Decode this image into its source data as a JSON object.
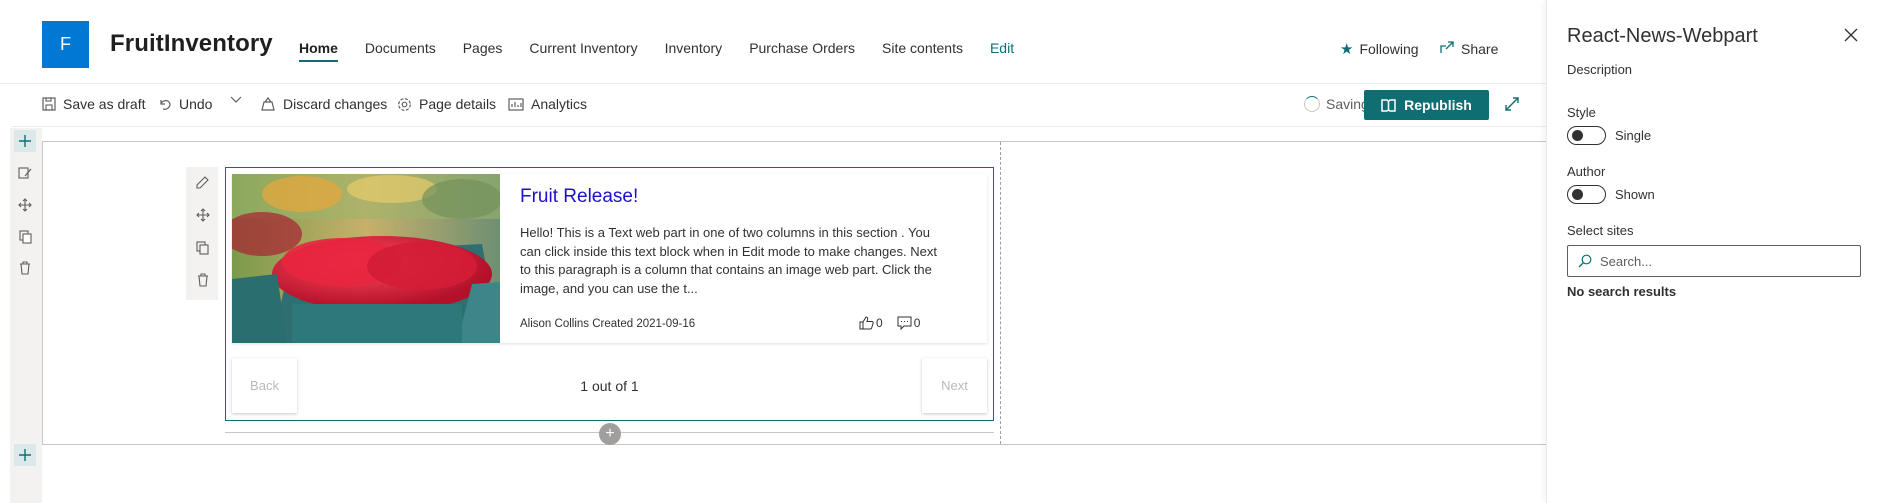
{
  "site": {
    "logo_letter": "F",
    "title": "FruitInventory",
    "nav": [
      {
        "label": "Home",
        "active": true
      },
      {
        "label": "Documents"
      },
      {
        "label": "Pages"
      },
      {
        "label": "Current Inventory"
      },
      {
        "label": "Inventory"
      },
      {
        "label": "Purchase Orders"
      },
      {
        "label": "Site contents"
      },
      {
        "label": "Edit"
      }
    ],
    "following_label": "Following",
    "share_label": "Share"
  },
  "commandbar": {
    "save_draft_label": "Save as draft",
    "undo_label": "Undo",
    "discard_label": "Discard changes",
    "page_details_label": "Page details",
    "analytics_label": "Analytics",
    "saving_label": "Saving",
    "republish_label": "Republish"
  },
  "webpart": {
    "news_item": {
      "title": "Fruit Release!",
      "description": "Hello! This is a Text web part in one of two columns in this section . You can click inside this text block when in Edit mode to make changes. Next to this paragraph is a column that contains an image web part. Click the image, and you can use the t...",
      "author_line": "Alison Collins Created 2021-09-16",
      "likes": "0",
      "comments": "0"
    },
    "pager": {
      "back_label": "Back",
      "next_label": "Next",
      "status": "1 out of 1"
    }
  },
  "panel": {
    "title": "React-News-Webpart",
    "description": "Description",
    "style_label": "Style",
    "style_toggle_text": "Single",
    "author_label": "Author",
    "author_toggle_text": "Shown",
    "select_sites_label": "Select sites",
    "search_placeholder": "Search...",
    "no_results": "No search results"
  },
  "colors": {
    "accent": "#0f6e72",
    "site_logo": "#0078d4",
    "news_title": "#1d10c9"
  }
}
